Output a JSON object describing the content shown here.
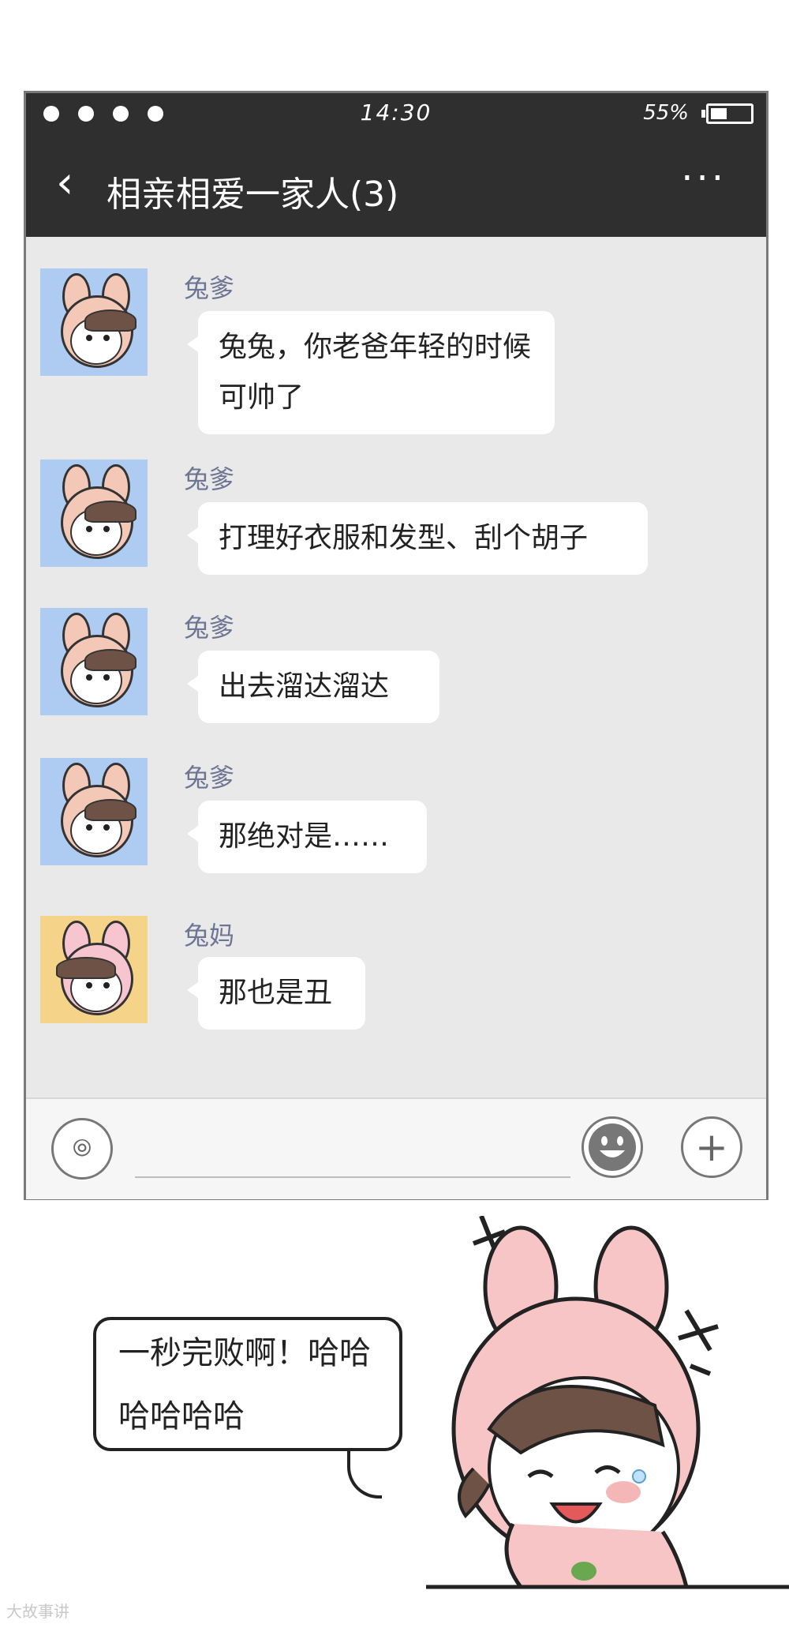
{
  "status_bar": {
    "time": "14:30",
    "battery_percent": "55%",
    "battery_level": 0.33
  },
  "header": {
    "back_icon": "chevron-left-icon",
    "title": "相亲相爱一家人(3)",
    "more_label": "···"
  },
  "messages": [
    {
      "sender": "兔爹",
      "avatar": "dad",
      "text": "兔兔，你老爸年轻的时候可帅了"
    },
    {
      "sender": "兔爹",
      "avatar": "dad",
      "text": "打理好衣服和发型、刮个胡子"
    },
    {
      "sender": "兔爹",
      "avatar": "dad",
      "text": "出去溜达溜达"
    },
    {
      "sender": "兔爹",
      "avatar": "dad",
      "text": "那绝对是……"
    },
    {
      "sender": "兔妈",
      "avatar": "mom",
      "text": "那也是丑"
    }
  ],
  "input_bar": {
    "voice_icon": "voice-icon",
    "emoji_icon": "emoji-icon",
    "plus_icon": "plus-icon"
  },
  "comic": {
    "speech_text": "一秒完败啊！哈哈哈哈哈哈"
  },
  "watermark": "大故事讲"
}
